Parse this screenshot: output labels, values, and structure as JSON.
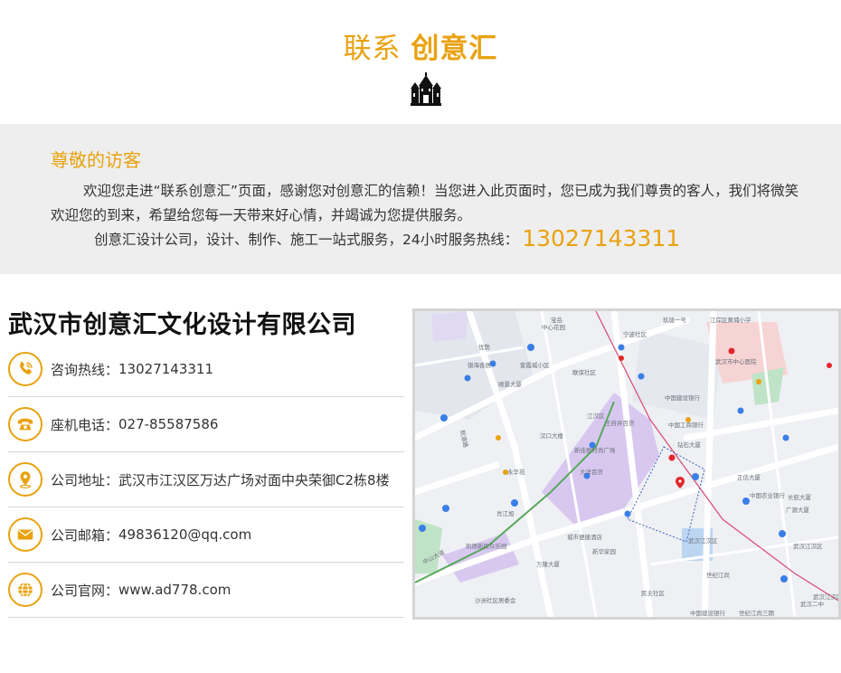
{
  "header": {
    "title_light": "联系",
    "title_bold": "创意汇"
  },
  "welcome": {
    "heading": "尊敬的访客",
    "paragraph": "欢迎您走进“联系创意汇”页面，感谢您对创意汇的信赖！当您进入此页面时，您已成为我们尊贵的客人，我们将微笑欢迎您的到来，希望给您每一天带来好心情，并竭诚为您提供服务。",
    "hotline_text": "创意汇设计公司，设计、制作、施工一站式服务，24小时服务热线：",
    "hotline_number": "13027143311"
  },
  "company": {
    "name": "武汉市创意汇文化设计有限公司",
    "rows": [
      {
        "icon": "phone-call-icon",
        "label": "咨询热线：",
        "value": "13027143311"
      },
      {
        "icon": "telephone-icon",
        "label": "座机电话：",
        "value": "027-85587586"
      },
      {
        "icon": "location-pin-icon",
        "label": "公司地址：",
        "value": "武汉市江汉区万达广场对面中央荣御C2栋8楼"
      },
      {
        "icon": "envelope-icon",
        "label": "公司邮箱：",
        "value": "49836120@qq.com"
      },
      {
        "icon": "globe-icon",
        "label": "公司官网：",
        "value": "www.ad778.com"
      }
    ]
  },
  "map": {
    "labels": [
      "宝岳",
      "中心花园",
      "宁波社区",
      "优勢",
      "银海香居",
      "紫霞城小区",
      "顺景大厦",
      "联保社区",
      "永华苑",
      "汉口大楼",
      "江汉区",
      "王府井百货",
      "新佳丽时尚广场",
      "大洋百货",
      "航道路",
      "城市便捷酒店",
      "万隆大厦",
      "凯德新民众乐园",
      "新华家园",
      "肖江旭",
      "中山大道",
      "沙洲社区居委会",
      "民主社区",
      "武汉江汉区",
      "江岸区黄埔小学",
      "武汉市中心医院",
      "中国建设银行",
      "中国工商银行",
      "钻石大厦",
      "正信大厦",
      "中国农业银行",
      "广源大厦",
      "长航大厦",
      "玖珑一号",
      "武汉江汉区",
      "世纪江尚",
      "武汉二中",
      "中国建设银行",
      "世纪江尚三期",
      "武汉江汉区"
    ],
    "colors": {
      "road": "#ffffff",
      "block": "#dfe3ea",
      "purple": "#d8c8f0",
      "pink": "#f7d4d4",
      "green": "#bfe3c6",
      "water": "#bcd6f2",
      "rail": "#d9527a",
      "poi": "#3a7ee8",
      "pin": "#e3262c"
    }
  }
}
